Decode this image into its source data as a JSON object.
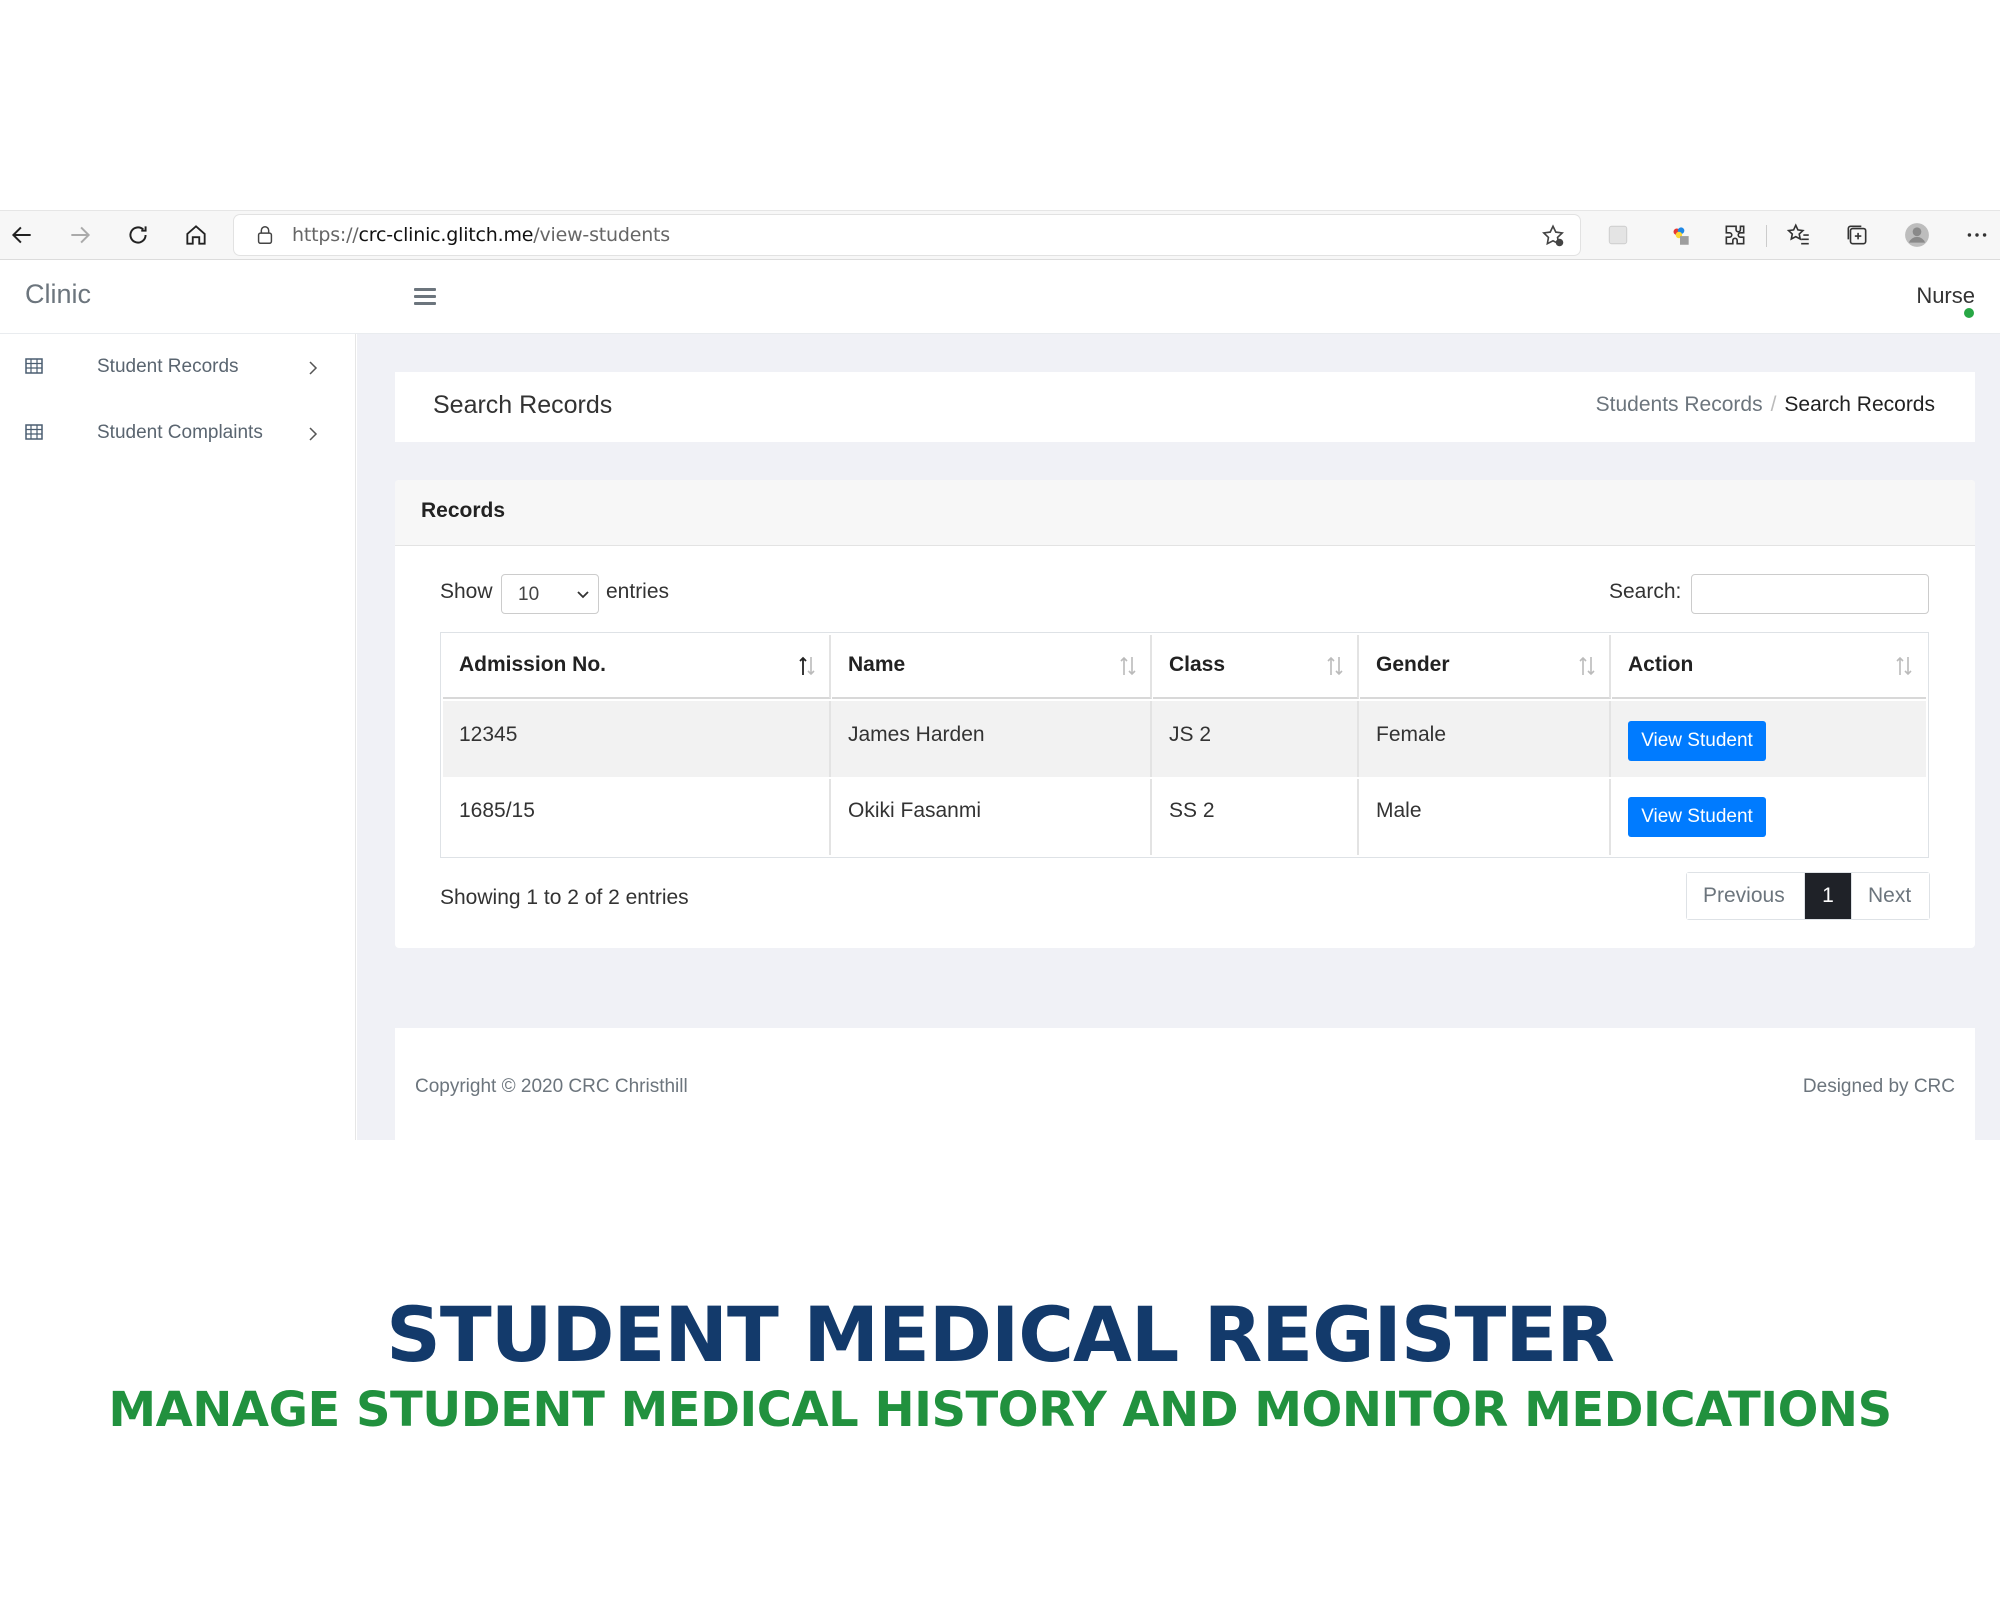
{
  "browser": {
    "url_scheme": "https://",
    "url_host": "crc-clinic.glitch.me",
    "url_path": "/view-students"
  },
  "header": {
    "brand": "Clinic",
    "user": "Nurse",
    "online_color": "#28a745"
  },
  "sidebar": {
    "items": [
      {
        "label": "Student Records",
        "icon": "table-icon"
      },
      {
        "label": "Student Complaints",
        "icon": "table-icon"
      }
    ]
  },
  "page": {
    "title": "Search Records",
    "breadcrumb": [
      "Students Records",
      "/",
      "Search Records"
    ]
  },
  "card": {
    "title": "Records",
    "show_label": "Show",
    "length_value": "10",
    "entries_label": "entries",
    "search_label": "Search:",
    "search_value": ""
  },
  "table": {
    "headers": [
      "Admission No.",
      "Name",
      "Class",
      "Gender",
      "Action"
    ],
    "rows": [
      {
        "admission": "12345",
        "name": "James Harden",
        "class": "JS 2",
        "gender": "Female",
        "action": "View Student"
      },
      {
        "admission": "1685/15",
        "name": "Okiki Fasanmi",
        "class": "SS 2",
        "gender": "Male",
        "action": "View Student"
      }
    ]
  },
  "pagination": {
    "info": "Showing 1 to 2 of 2 entries",
    "previous": "Previous",
    "current": "1",
    "next": "Next"
  },
  "footer": {
    "copyright": "Copyright © 2020 CRC Christhill",
    "designed_by": "Designed by CRC"
  },
  "caption": {
    "headline": "STUDENT MEDICAL REGISTER",
    "subline": "MANAGE STUDENT MEDICAL HISTORY AND MONITOR MEDICATIONS"
  },
  "colors": {
    "accent": "#007bff",
    "headline": "#133a6b",
    "subline": "#21913e",
    "active_page": "#1f2228"
  }
}
